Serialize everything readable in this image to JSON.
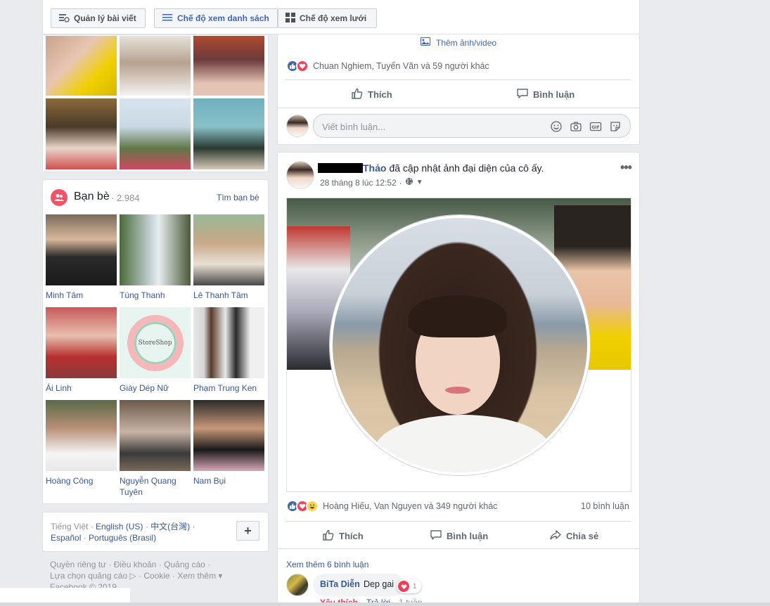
{
  "toolbar": {
    "manage_posts": "Quản lý bài viết",
    "list_view": "Chế độ xem danh sách",
    "grid_view": "Chế độ xem lưới"
  },
  "friends": {
    "title": "Bạn bè",
    "count": "2.984",
    "find_link": "Tìm bạn bè",
    "items": [
      {
        "name": "Minh Tâm"
      },
      {
        "name": "Tùng Thanh"
      },
      {
        "name": "Lê Thanh Tâm"
      },
      {
        "name": "Ái Linh"
      },
      {
        "name": "Giày Dép Nữ"
      },
      {
        "name": "Phạm Trung Ken"
      },
      {
        "name": "Hoàng Công"
      },
      {
        "name": "Nguyễn Quang Tuyên"
      },
      {
        "name": "Nam Bụi"
      }
    ],
    "store_text": "StoreShop"
  },
  "language": {
    "current": "Tiếng Việt",
    "options": [
      "English (US)",
      "中文(台灣)",
      "Español",
      "Português (Brasil)"
    ],
    "add_label": "+"
  },
  "footer": {
    "privacy": "Quyền riêng tư",
    "terms": "Điều khoản",
    "ads": "Quảng cáo",
    "ad_choices": "Lựa chọn quảng cáo",
    "cookies": "Cookie",
    "more": "Xem thêm",
    "copyright": "Facebook © 2019"
  },
  "post1": {
    "add_photo": "Thêm ảnh/video",
    "reactions": "Chuan Nghiem, Tuyển Văn và 59 người khác",
    "like": "Thích",
    "comment": "Bình luận",
    "comment_placeholder": "Viết bình luận..."
  },
  "post2": {
    "author": "Thảo",
    "action": "đã cập nhật ảnh đại diện của cô ấy.",
    "time": "28 tháng 8 lúc 12:52",
    "reactions": "Hoàng Hiếu, Van Nguyen và 349 người khác",
    "comments_count": "10 bình luận",
    "like": "Thích",
    "comment": "Bình luận",
    "share": "Chia sẻ",
    "view_more": "Xem thêm 6 bình luận",
    "comment_author": "BiTa Diễn",
    "comment_text": "Dep gai",
    "comment_react_count": "1",
    "reply_like": "Yêu thích",
    "reply": "Trả lời",
    "reply_time": "1 tuần"
  },
  "colors": {
    "brand": "#4267b2",
    "link": "#385898",
    "heart": "#f33e58",
    "friends_icon": "#f35369"
  }
}
